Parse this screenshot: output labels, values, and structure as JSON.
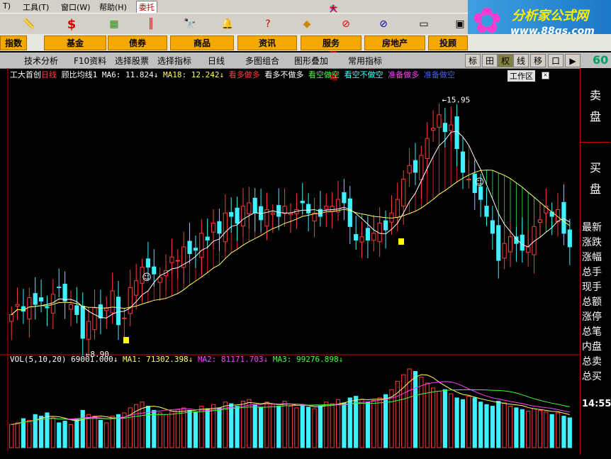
{
  "menu": {
    "tools": "工具(T)",
    "window": "窗口(W)",
    "help": "帮助(H)",
    "entrust": "委托",
    "title": "大智慧金融终端"
  },
  "logo": {
    "name": "分析家公式网",
    "url": "www.88gs.com"
  },
  "workspace_label": "工作区",
  "categories": [
    "指数",
    "基金",
    "债券",
    "商品",
    "资讯",
    "服务",
    "房地产",
    "投顾"
  ],
  "tabs": [
    "技术分析",
    "F10资料",
    "选择股票",
    "选择指标",
    "日线",
    "多图组合",
    "图形叠加",
    "常用指标"
  ],
  "right_tabs": [
    "标",
    "田",
    "权",
    "线",
    "移",
    "口",
    "▶"
  ],
  "right_num": "60",
  "price_info": {
    "stock": "工大首创",
    "period": "日线",
    "indicator": "顾比均线1",
    "ma6": "MA6: 11.824↓",
    "ma18": "MA18: 12.242↓",
    "s1": "看多做多",
    "s2": "看多不做多",
    "s3": "看空做空",
    "s4": "看空不做空",
    "s5": "准备做多",
    "s6": "准备做空"
  },
  "labels": {
    "low": "8.90",
    "high": "15.95"
  },
  "vol_info": {
    "name": "VOL(5,10,20)",
    "v": "69001.000↓",
    "ma1": "MA1: 71302.398↓",
    "ma2": "MA2: 81171.703↓",
    "ma3": "MA3: 99276.898↓"
  },
  "side": {
    "sell": "卖盘",
    "buy": "买盘",
    "items": [
      "最新",
      "涨跌",
      "涨幅",
      "总手",
      "现手",
      "总额",
      "涨停",
      "总笔",
      "内盘",
      "总卖",
      "总买"
    ],
    "time": "14:55"
  },
  "colors": {
    "up": "#ff3b3b",
    "down": "#3ff0ff",
    "ma_short": "#ffffff",
    "ma_long": "#ffff60",
    "vol_ma2": "#ff40ff",
    "vol_ma3": "#40ff40"
  },
  "chart_data": {
    "type": "candlestick",
    "closes": [
      9.6,
      9.9,
      9.7,
      10.1,
      9.9,
      10.0,
      9.8,
      10.2,
      10.4,
      10.0,
      9.9,
      9.6,
      8.9,
      9.4,
      9.8,
      9.5,
      9.8,
      10.3,
      9.3,
      9.5,
      10.4,
      10.6,
      11.0,
      11.0,
      10.8,
      10.7,
      10.9,
      11.3,
      11.2,
      11.6,
      11.4,
      11.5,
      12.0,
      11.8,
      12.3,
      12.0,
      12.6,
      12.5,
      12.3,
      12.8,
      12.9,
      12.6,
      12.4,
      12.7,
      12.6,
      12.5,
      12.8,
      12.6,
      12.7,
      12.9,
      12.6,
      12.6,
      12.5,
      12.8,
      12.8,
      13.0,
      12.9,
      12.2,
      11.8,
      11.9,
      11.8,
      12.0,
      12.3,
      12.1,
      12.6,
      13.0,
      13.6,
      14.0,
      13.8,
      14.3,
      14.8,
      15.1,
      15.5,
      15.0,
      15.2,
      14.5,
      13.8,
      13.6,
      13.2,
      13.0,
      12.5,
      12.0,
      11.2,
      11.7,
      11.9,
      11.7,
      11.5,
      11.6,
      12.2,
      12.4,
      12.8,
      12.5,
      12.7,
      12.0,
      11.6
    ],
    "volumes": [
      28,
      30,
      35,
      33,
      40,
      38,
      42,
      36,
      30,
      32,
      28,
      35,
      45,
      40,
      38,
      33,
      30,
      38,
      40,
      42,
      48,
      52,
      55,
      50,
      45,
      42,
      40,
      44,
      46,
      48,
      45,
      43,
      50,
      47,
      52,
      48,
      55,
      53,
      50,
      56,
      58,
      52,
      49,
      55,
      52,
      50,
      56,
      50,
      48,
      52,
      49,
      47,
      50,
      55,
      53,
      58,
      54,
      60,
      62,
      58,
      55,
      57,
      60,
      64,
      70,
      80,
      88,
      95,
      92,
      85,
      78,
      72,
      68,
      70,
      65,
      60,
      58,
      62,
      60,
      55,
      52,
      50,
      56,
      54,
      50,
      48,
      46,
      44,
      47,
      45,
      43,
      40,
      42,
      38,
      36
    ],
    "price_range": [
      8.5,
      16.5
    ],
    "low_label": 8.9,
    "high_label": 15.95
  }
}
